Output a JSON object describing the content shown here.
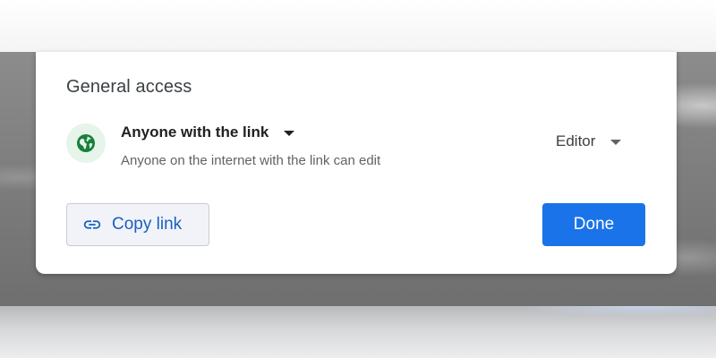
{
  "dialog": {
    "section_title": "General access",
    "access": {
      "scope_label": "Anyone with the link",
      "description": "Anyone on the internet with the link can edit",
      "icon": "globe-icon",
      "icon_color": "#188038",
      "icon_background": "#e6f4ea"
    },
    "role": {
      "selected": "Editor"
    },
    "actions": {
      "copy_link_label": "Copy link",
      "copy_link_icon": "link-icon",
      "done_label": "Done"
    },
    "colors": {
      "accent": "#1a73e8",
      "link_text": "#1a5fbf"
    }
  }
}
